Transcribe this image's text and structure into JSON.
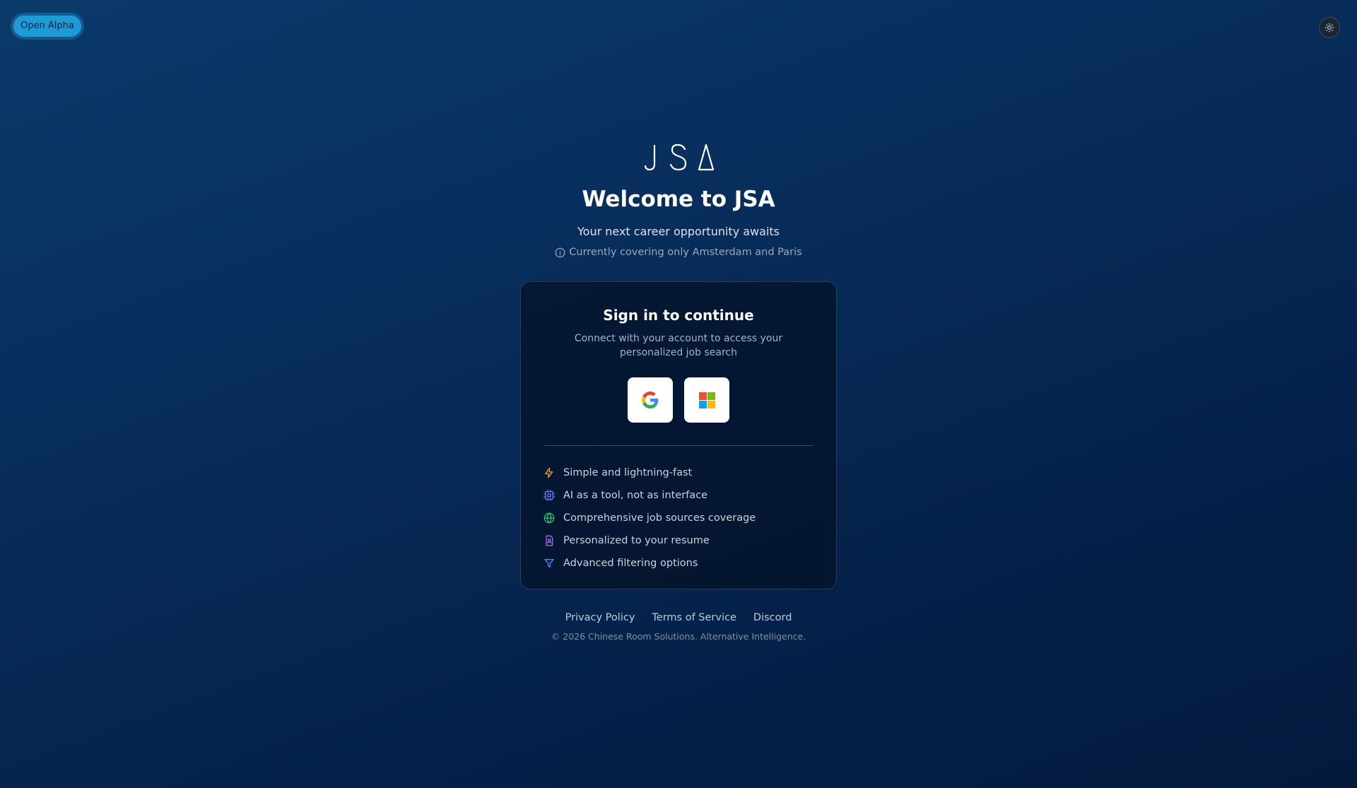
{
  "badge": {
    "label": "Open Alpha"
  },
  "theme_toggle": {
    "icon": "sun-icon"
  },
  "hero": {
    "logo_text": "JSA",
    "title": "Welcome to JSA",
    "tagline": "Your next career opportunity awaits",
    "coverage_note": "Currently covering only Amsterdam and Paris"
  },
  "signin": {
    "title": "Sign in to continue",
    "subtitle": "Connect with your account to access your personalized job search",
    "providers": [
      {
        "name": "Google",
        "icon": "google-icon"
      },
      {
        "name": "Microsoft",
        "icon": "microsoft-icon"
      }
    ]
  },
  "features": [
    {
      "label": "Simple and lightning-fast",
      "icon": "lightning-icon",
      "color": "#e0a320"
    },
    {
      "label": "AI as a tool, not as interface",
      "icon": "chip-icon",
      "color": "#6b7cff"
    },
    {
      "label": "Comprehensive job sources coverage",
      "icon": "globe-icon",
      "color": "#2fbf6f"
    },
    {
      "label": "Personalized to your resume",
      "icon": "resume-icon",
      "color": "#a86bf0"
    },
    {
      "label": "Advanced filtering options",
      "icon": "filter-icon",
      "color": "#4a8ef0"
    }
  ],
  "footer": {
    "links": [
      "Privacy Policy",
      "Terms of Service",
      "Discord"
    ],
    "copyright": "© 2026 Chinese Room Solutions. Alternative Intelligence."
  },
  "colors": {
    "accent": "#1e9ad6",
    "background": "#072a55"
  }
}
